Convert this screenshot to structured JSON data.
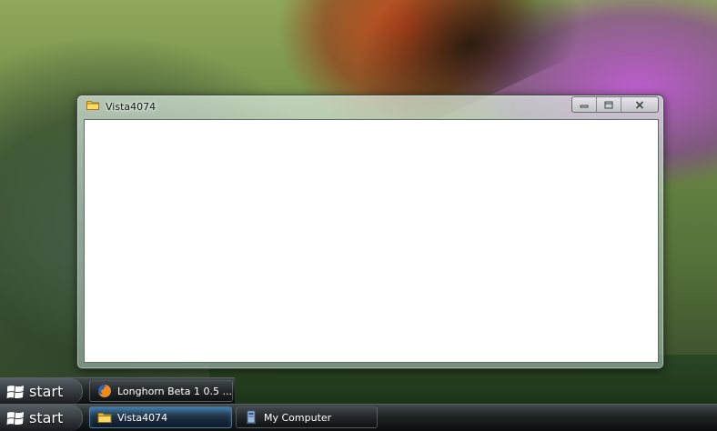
{
  "window": {
    "title": "Vista4074",
    "title_icon": "folder-icon",
    "buttons": {
      "minimize_icon": "minimize-icon",
      "maximize_icon": "maximize-icon",
      "close_icon": "close-icon"
    }
  },
  "taskbar_top": {
    "start_label": "start",
    "tasks": [
      {
        "label": "Longhorn Beta 1 0.5 ...",
        "icon": "firefox-icon"
      }
    ]
  },
  "taskbar_bottom": {
    "start_label": "start",
    "tasks": [
      {
        "label": "Vista4074",
        "icon": "folder-icon",
        "active": true
      },
      {
        "label": "My Computer",
        "icon": "computer-icon",
        "active": false
      }
    ]
  }
}
